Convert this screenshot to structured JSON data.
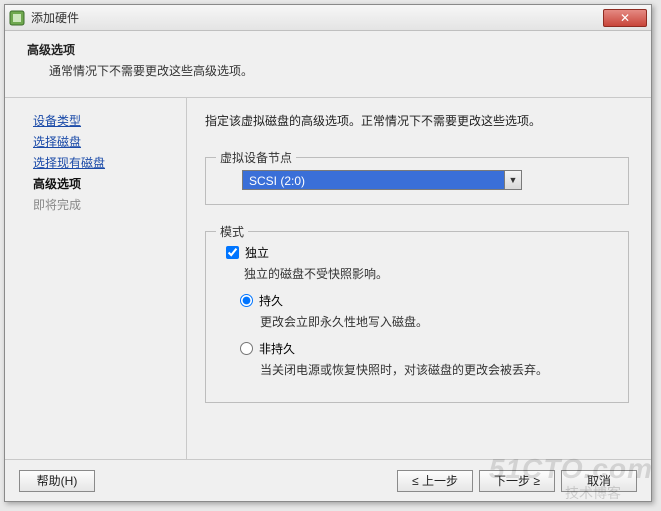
{
  "window": {
    "title": "添加硬件"
  },
  "header": {
    "title": "高级选项",
    "subtitle": "通常情况下不需要更改这些高级选项。"
  },
  "sidebar": {
    "steps": [
      {
        "label": "设备类型"
      },
      {
        "label": "选择磁盘"
      },
      {
        "label": "选择现有磁盘"
      },
      {
        "label": "高级选项"
      },
      {
        "label": "即将完成"
      }
    ]
  },
  "content": {
    "instruction": "指定该虚拟磁盘的高级选项。正常情况下不需要更改这些选项。",
    "virtual_node": {
      "legend": "虚拟设备节点",
      "selected": "SCSI (2:0)"
    },
    "mode": {
      "legend": "模式",
      "independent_label": "独立",
      "independent_checked": true,
      "independent_desc": "独立的磁盘不受快照影响。",
      "persist_label": "持久",
      "persist_desc": "更改会立即永久性地写入磁盘。",
      "nonpersist_label": "非持久",
      "nonpersist_desc": "当关闭电源或恢复快照时，对该磁盘的更改会被丢弃。",
      "mode_selected": "persist"
    }
  },
  "footer": {
    "help": "帮助(H)",
    "back": "≤ 上一步",
    "next": "下一步 ≥",
    "cancel": "取消"
  },
  "watermark": {
    "line1": "51CTO.com",
    "line2": "技术博客"
  }
}
